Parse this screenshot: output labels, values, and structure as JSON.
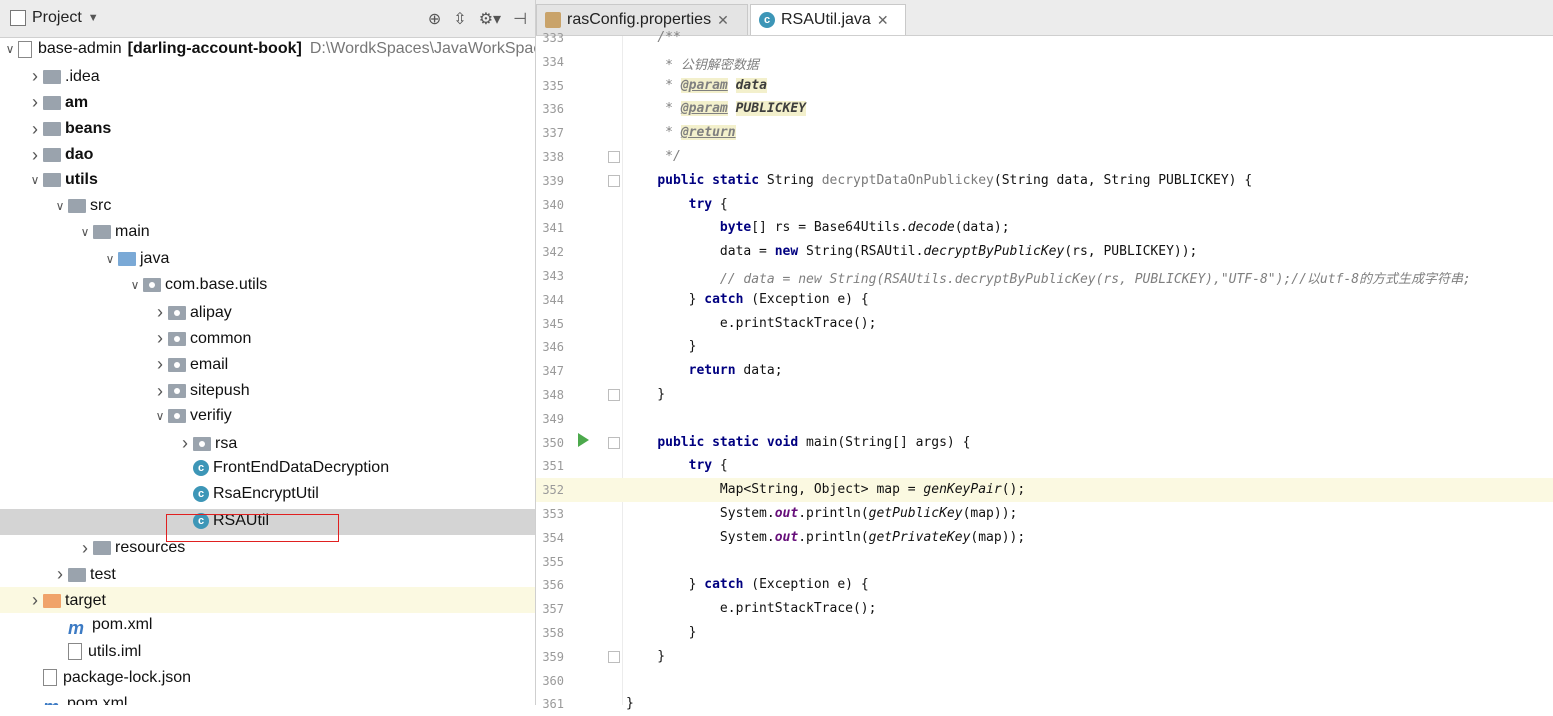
{
  "project_panel": {
    "title": "Project",
    "tree": [
      {
        "label": "base-admin",
        "bold_suffix": "[darling-account-book]",
        "path": "D:\\WordkSpaces\\JavaWorkSpace",
        "icon": "module-icon",
        "indent": 0,
        "arrow": "down"
      },
      {
        "label": ".idea",
        "icon": "folder-icon",
        "indent": 1,
        "arrow": "right"
      },
      {
        "label": "am",
        "icon": "module-folder-icon",
        "indent": 1,
        "arrow": "right",
        "bold": true
      },
      {
        "label": "beans",
        "icon": "module-folder-icon",
        "indent": 1,
        "arrow": "right",
        "bold": true
      },
      {
        "label": "dao",
        "icon": "module-folder-icon",
        "indent": 1,
        "arrow": "right",
        "bold": true
      },
      {
        "label": "utils",
        "icon": "module-folder-icon",
        "indent": 1,
        "arrow": "down",
        "bold": true
      },
      {
        "label": "src",
        "icon": "folder-icon",
        "indent": 2,
        "arrow": "down"
      },
      {
        "label": "main",
        "icon": "folder-icon",
        "indent": 3,
        "arrow": "down"
      },
      {
        "label": "java",
        "icon": "source-folder-icon",
        "indent": 4,
        "arrow": "down"
      },
      {
        "label": "com.base.utils",
        "icon": "package-icon",
        "indent": 5,
        "arrow": "down"
      },
      {
        "label": "alipay",
        "icon": "package-icon",
        "indent": 6,
        "arrow": "right"
      },
      {
        "label": "common",
        "icon": "package-icon",
        "indent": 6,
        "arrow": "right"
      },
      {
        "label": "email",
        "icon": "package-icon",
        "indent": 6,
        "arrow": "right"
      },
      {
        "label": "sitepush",
        "icon": "package-icon",
        "indent": 6,
        "arrow": "right"
      },
      {
        "label": "verifiy",
        "icon": "package-icon",
        "indent": 6,
        "arrow": "down"
      },
      {
        "label": "rsa",
        "icon": "package-icon",
        "indent": 7,
        "arrow": "right"
      },
      {
        "label": "FrontEndDataDecryption",
        "icon": "java-class-icon",
        "indent": 7,
        "arrow": ""
      },
      {
        "label": "RsaEncryptUtil",
        "icon": "java-class-icon",
        "indent": 7,
        "arrow": ""
      },
      {
        "label": "RSAUtil",
        "icon": "java-class-icon",
        "indent": 7,
        "arrow": "",
        "selected": true
      },
      {
        "label": "resources",
        "icon": "resources-folder-icon",
        "indent": 3,
        "arrow": "right"
      },
      {
        "label": "test",
        "icon": "folder-icon",
        "indent": 2,
        "arrow": "right"
      },
      {
        "label": "target",
        "icon": "excluded-folder-icon",
        "indent": 1,
        "arrow": "right",
        "highlight": true
      },
      {
        "label": "pom.xml",
        "icon": "maven-icon",
        "indent": 2,
        "arrow": ""
      },
      {
        "label": "utils.iml",
        "icon": "file-icon",
        "indent": 2,
        "arrow": ""
      },
      {
        "label": "package-lock.json",
        "icon": "json-file-icon",
        "indent": 1,
        "arrow": ""
      },
      {
        "label": "pom.xml",
        "icon": "maven-icon",
        "indent": 1,
        "arrow": ""
      }
    ]
  },
  "tabs": [
    {
      "label": "rasConfig.properties",
      "icon": "properties-file-icon",
      "active": false
    },
    {
      "label": "RSAUtil.java",
      "icon": "java-class-icon",
      "active": true
    }
  ],
  "editor": {
    "current_line": "352",
    "run_line": "350",
    "lines": [
      {
        "n": "333",
        "html": "    <span class='cm'>/**</span>"
      },
      {
        "n": "334",
        "html": "     <span class='cm'>* 公钥解密数据</span>"
      },
      {
        "n": "335",
        "html": "     <span class='cm'>* </span><span class='tag'>@param</span> <span class='cm' style='font-weight:bold;background:#f3f0cc;color:#3d3d3d'>data</span>"
      },
      {
        "n": "336",
        "html": "     <span class='cm'>* </span><span class='tag'>@param</span> <span class='cm' style='font-weight:bold;background:#f3f0cc;color:#3d3d3d'>PUBLICKEY</span>"
      },
      {
        "n": "337",
        "html": "     <span class='cm'>* </span><span class='tag'>@return</span>"
      },
      {
        "n": "338",
        "html": "     <span class='cm'>*/</span>"
      },
      {
        "n": "339",
        "html": "    <span class='kw'>public static</span> String <span style='color:#7a7a7a'>decryptDataOnPublickey</span>(String data, String PUBLICKEY) {"
      },
      {
        "n": "340",
        "html": "        <span class='kw'>try</span> {"
      },
      {
        "n": "341",
        "html": "            <span class='kw'>byte</span>[] rs = Base64Utils.<span class='it'>decode</span>(data);"
      },
      {
        "n": "342",
        "html": "            data = <span class='kw'>new</span> String(RSAUtil.<span class='it'>decryptByPublicKey</span>(rs, PUBLICKEY));"
      },
      {
        "n": "343",
        "html": "            <span class='cm'>// data = new String(RSAUtils.decryptByPublicKey(rs, PUBLICKEY),\"UTF-8\");//以utf-8的方式生成字符串;</span>"
      },
      {
        "n": "344",
        "html": "        } <span class='kw'>catch</span> (Exception e) {"
      },
      {
        "n": "345",
        "html": "            e.printStackTrace();"
      },
      {
        "n": "346",
        "html": "        }"
      },
      {
        "n": "347",
        "html": "        <span class='kw'>return</span> data;"
      },
      {
        "n": "348",
        "html": "    }"
      },
      {
        "n": "349",
        "html": ""
      },
      {
        "n": "350",
        "html": "    <span class='kw'>public static void</span> main(String[] args) {"
      },
      {
        "n": "351",
        "html": "        <span class='kw'>try</span> {"
      },
      {
        "n": "352",
        "html": "            Map&lt;String, Object&gt; map = <span class='it'>genKeyPair</span>();"
      },
      {
        "n": "353",
        "html": "            System.<span class='ot'>out</span>.println(<span class='it'>getPublicKey</span>(map));"
      },
      {
        "n": "354",
        "html": "            System.<span class='ot'>out</span>.println(<span class='it'>getPrivateKey</span>(map));"
      },
      {
        "n": "355",
        "html": ""
      },
      {
        "n": "356",
        "html": "        } <span class='kw'>catch</span> (Exception e) {"
      },
      {
        "n": "357",
        "html": "            e.printStackTrace();"
      },
      {
        "n": "358",
        "html": "        }"
      },
      {
        "n": "359",
        "html": "    }"
      },
      {
        "n": "360",
        "html": ""
      },
      {
        "n": "361",
        "html": "}"
      }
    ]
  }
}
